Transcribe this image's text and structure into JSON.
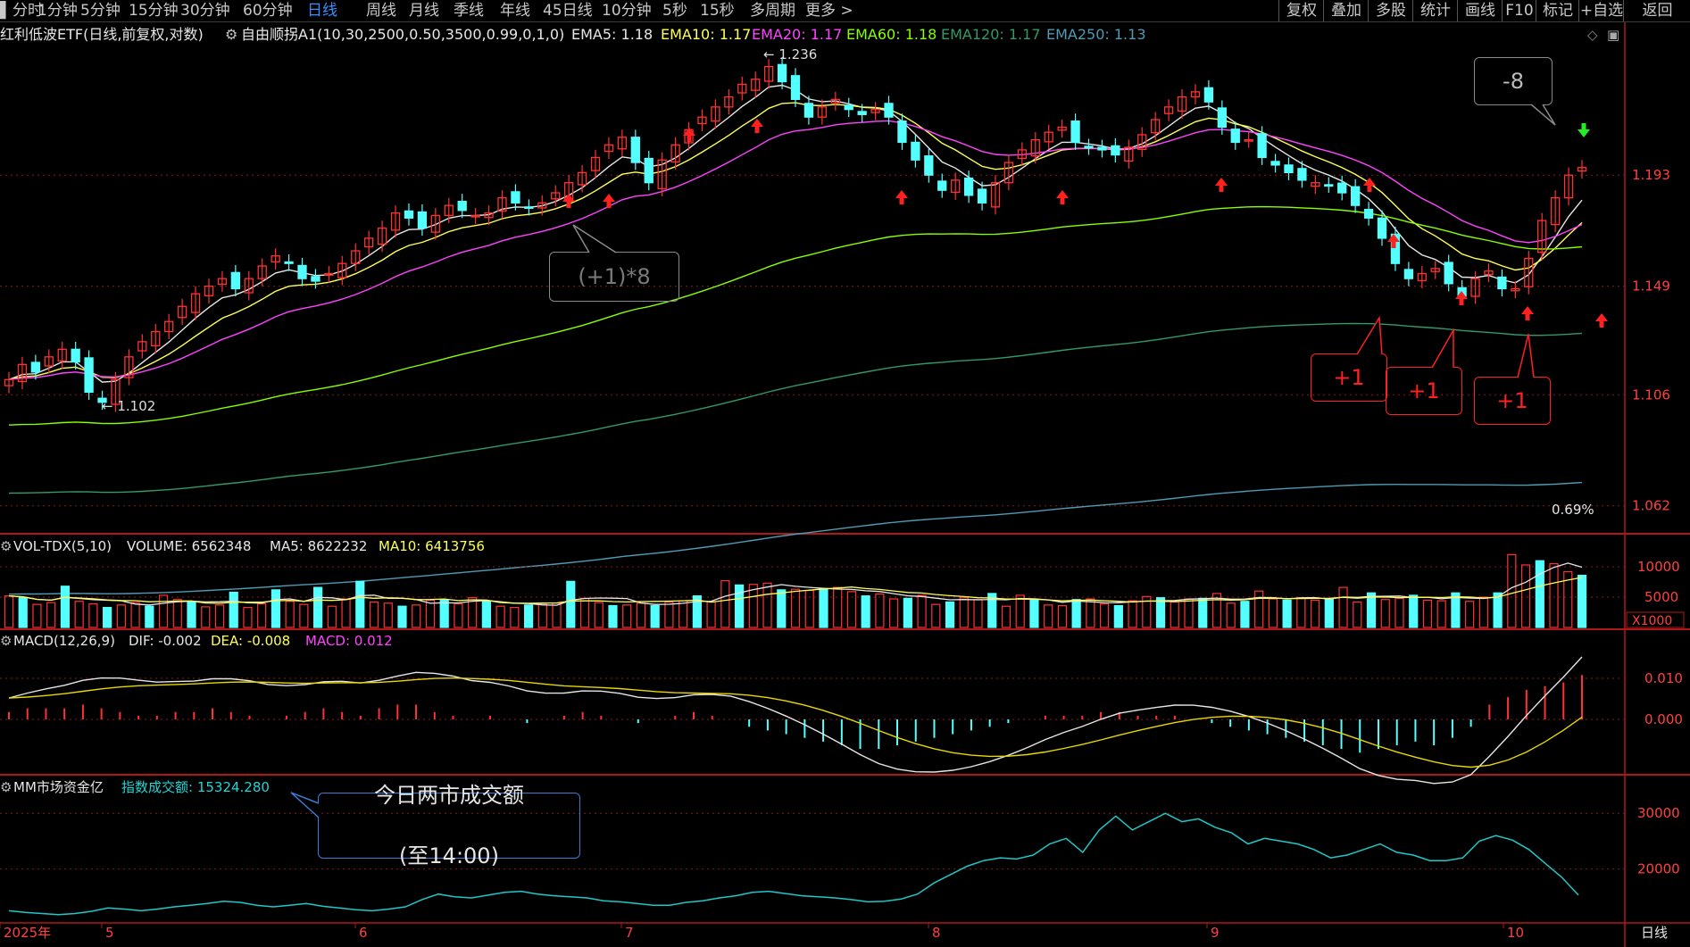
{
  "toolbar": {
    "left_items": [
      "分时",
      "1分钟",
      "5分钟",
      "15分钟",
      "30分钟",
      "60分钟",
      "日线",
      "周线",
      "月线",
      "季线",
      "年线",
      "45日线",
      "10分钟",
      "5秒",
      "15秒",
      "多周期",
      "更多 >"
    ],
    "active": "日线",
    "right_items": [
      "复权",
      "叠加",
      "多股",
      "统计",
      "画线",
      "F10",
      "标记",
      "+自选",
      "返回"
    ]
  },
  "header": {
    "title": "红利低波ETF(日线,前复权,对数)",
    "indicator": "自由顺拐A1(10,30,2500,0.50,3500,0.99,0,1,0)",
    "ema_items": [
      {
        "text": "EMA5: 1.18",
        "color": "#e6e6e6"
      },
      {
        "text": "EMA10: 1.17",
        "color": "#ffff55"
      },
      {
        "text": "EMA20: 1.17",
        "color": "#ff44ff"
      },
      {
        "text": "EMA60: 1.18",
        "color": "#88ff00"
      },
      {
        "text": "EMA120: 1.17",
        "color": "#339966"
      },
      {
        "text": "EMA250: 1.13",
        "color": "#4f9ab5"
      }
    ]
  },
  "price_axis": [
    "1.193",
    "1.149",
    "1.106",
    "1.062"
  ],
  "price_markers": {
    "high": "1.236",
    "low": "1.102",
    "pct": "0.69%"
  },
  "volume_panel": {
    "label": "VOL-TDX(5,10)",
    "volume": "VOLUME: 6562348",
    "ma5": "MA5: 8622232",
    "ma10": "MA10: 6413756",
    "axis": [
      "10000",
      "5000"
    ],
    "unit": "X1000"
  },
  "macd_panel": {
    "label": "MACD(12,26,9)",
    "dif": "DIF: -0.002",
    "dea": "DEA: -0.008",
    "macd": "MACD: 0.012",
    "axis": [
      "0.010",
      "0.000"
    ]
  },
  "mm_panel": {
    "label": "MM市场资金亿",
    "index_label": "指数成交额: 15324.280",
    "axis": [
      "30000",
      "20000"
    ]
  },
  "date_axis": {
    "labels": [
      "2025年",
      "5",
      "6",
      "7",
      "8",
      "9",
      "10"
    ],
    "period_tab": "日线"
  },
  "annotations": {
    "plus8": "(+1)*8",
    "minus8": "-8",
    "plus1": "+1",
    "mm_note_line1": "今日两市成交额",
    "mm_note_line2": "(至14:00)"
  },
  "colors": {
    "up": "#ff3232",
    "down": "#54ffff",
    "grid": "#8a1a1a",
    "axis": "#cc2222",
    "highlight": "#3a8fff"
  },
  "chart_data": {
    "type": "candlestick",
    "months": [
      "2025-05",
      "2025-06",
      "2025-07",
      "2025-08",
      "2025-09",
      "2025-10"
    ],
    "closes": [
      1.112,
      1.118,
      1.115,
      1.121,
      1.124,
      1.119,
      1.107,
      1.103,
      1.112,
      1.121,
      1.127,
      1.131,
      1.135,
      1.141,
      1.146,
      1.149,
      1.152,
      1.148,
      1.152,
      1.157,
      1.161,
      1.158,
      1.152,
      1.151,
      1.154,
      1.158,
      1.163,
      1.168,
      1.172,
      1.178,
      1.176,
      1.172,
      1.177,
      1.181,
      1.179,
      1.177,
      1.178,
      1.184,
      1.182,
      1.18,
      1.182,
      1.186,
      1.19,
      1.194,
      1.2,
      1.205,
      1.208,
      1.198,
      1.19,
      1.199,
      1.205,
      1.211,
      1.216,
      1.22,
      1.224,
      1.229,
      1.231,
      1.236,
      1.23,
      1.223,
      1.216,
      1.22,
      1.223,
      1.219,
      1.217,
      1.219,
      1.216,
      1.206,
      1.199,
      1.193,
      1.187,
      1.191,
      1.185,
      1.182,
      1.19,
      1.198,
      1.203,
      1.207,
      1.21,
      1.212,
      1.206,
      1.204,
      1.203,
      1.201,
      1.204,
      1.209,
      1.215,
      1.22,
      1.224,
      1.226,
      1.222,
      1.212,
      1.206,
      1.207,
      1.2,
      1.197,
      1.194,
      1.191,
      1.19,
      1.189,
      1.186,
      1.181,
      1.176,
      1.168,
      1.158,
      1.152,
      1.154,
      1.156,
      1.15,
      1.145,
      1.152,
      1.155,
      1.148,
      1.148,
      1.16,
      1.175,
      1.184,
      1.193,
      1.196
    ],
    "volume_x1000": [
      5200,
      4900,
      3800,
      4100,
      6800,
      4300,
      3900,
      3300,
      3700,
      4100,
      3500,
      5300,
      4600,
      4200,
      3400,
      3700,
      5800,
      3300,
      3900,
      6200,
      4300,
      3800,
      6600,
      3500,
      4700,
      7600,
      4200,
      4000,
      3500,
      3700,
      4500,
      4600,
      3900,
      4900,
      4300,
      3500,
      3300,
      3700,
      3800,
      4000,
      7600,
      4800,
      4100,
      3600,
      3700,
      4000,
      3600,
      4200,
      4400,
      5200,
      4200,
      7700,
      7000,
      7100,
      7300,
      6200,
      6300,
      6100,
      6400,
      6600,
      5900,
      5200,
      5500,
      4700,
      4800,
      5300,
      3800,
      4200,
      4900,
      4600,
      5600,
      3500,
      5300,
      4600,
      3700,
      3600,
      4600,
      4700,
      3900,
      3600,
      4400,
      5100,
      4900,
      4200,
      4700,
      4800,
      5600,
      4000,
      4300,
      6000,
      4700,
      4500,
      4900,
      4500,
      4600,
      6600,
      4200,
      5700,
      4600,
      4800,
      5300,
      4500,
      4400,
      5700,
      4300,
      5000,
      5700,
      12000,
      10300,
      11000,
      10500,
      9200,
      8600
    ],
    "macd": [
      0.002,
      0.003,
      0.003,
      0.003,
      0.004,
      0.003,
      0.002,
      0.001,
      0.001,
      0.002,
      0.002,
      0.003,
      0.002,
      0.001,
      0.0,
      0.001,
      0.002,
      0.003,
      0.002,
      0.001,
      0.003,
      0.004,
      0.004,
      0.002,
      0.001,
      0.0,
      0.001,
      0.0,
      -0.001,
      0.0,
      0.001,
      0.002,
      0.001,
      0.0,
      -0.001,
      0.0,
      0.001,
      0.002,
      0.001,
      0.0,
      -0.002,
      -0.003,
      -0.004,
      -0.005,
      -0.006,
      -0.007,
      -0.008,
      -0.008,
      -0.007,
      -0.006,
      -0.005,
      -0.004,
      -0.003,
      -0.002,
      -0.001,
      0.0,
      0.001,
      0.001,
      0.001,
      0.002,
      0.002,
      0.001,
      0.001,
      0.001,
      0.0,
      -0.001,
      -0.002,
      -0.003,
      -0.004,
      -0.005,
      -0.006,
      -0.007,
      -0.008,
      -0.009,
      -0.008,
      -0.007,
      -0.006,
      -0.007,
      -0.005,
      -0.002,
      0.004,
      0.006,
      0.008,
      0.009,
      0.01,
      0.012
    ],
    "mm_turnover": [
      12500,
      12200,
      12000,
      11800,
      12000,
      12400,
      13000,
      12800,
      12500,
      12800,
      13200,
      13500,
      13800,
      14200,
      14000,
      13500,
      13200,
      13500,
      13800,
      13300,
      13000,
      12700,
      12500,
      12800,
      13200,
      14500,
      15500,
      15000,
      14800,
      15300,
      15800,
      16000,
      15500,
      15200,
      15000,
      14800,
      14300,
      14100,
      13800,
      13500,
      13500,
      14000,
      14300,
      14800,
      15200,
      15800,
      16000,
      15600,
      15200,
      15000,
      14800,
      14500,
      14100,
      14200,
      14600,
      15500,
      17500,
      19000,
      20500,
      21500,
      22000,
      21800,
      22500,
      24500,
      25500,
      23000,
      27000,
      29500,
      27000,
      28500,
      30000,
      28500,
      29000,
      27500,
      26500,
      24500,
      25500,
      25000,
      24500,
      23500,
      22000,
      22500,
      23500,
      24500,
      23000,
      22500,
      21500,
      21500,
      22000,
      25000,
      26000,
      25200,
      23500,
      21000,
      18500,
      15300
    ],
    "price_range": [
      1.058,
      1.25
    ]
  }
}
